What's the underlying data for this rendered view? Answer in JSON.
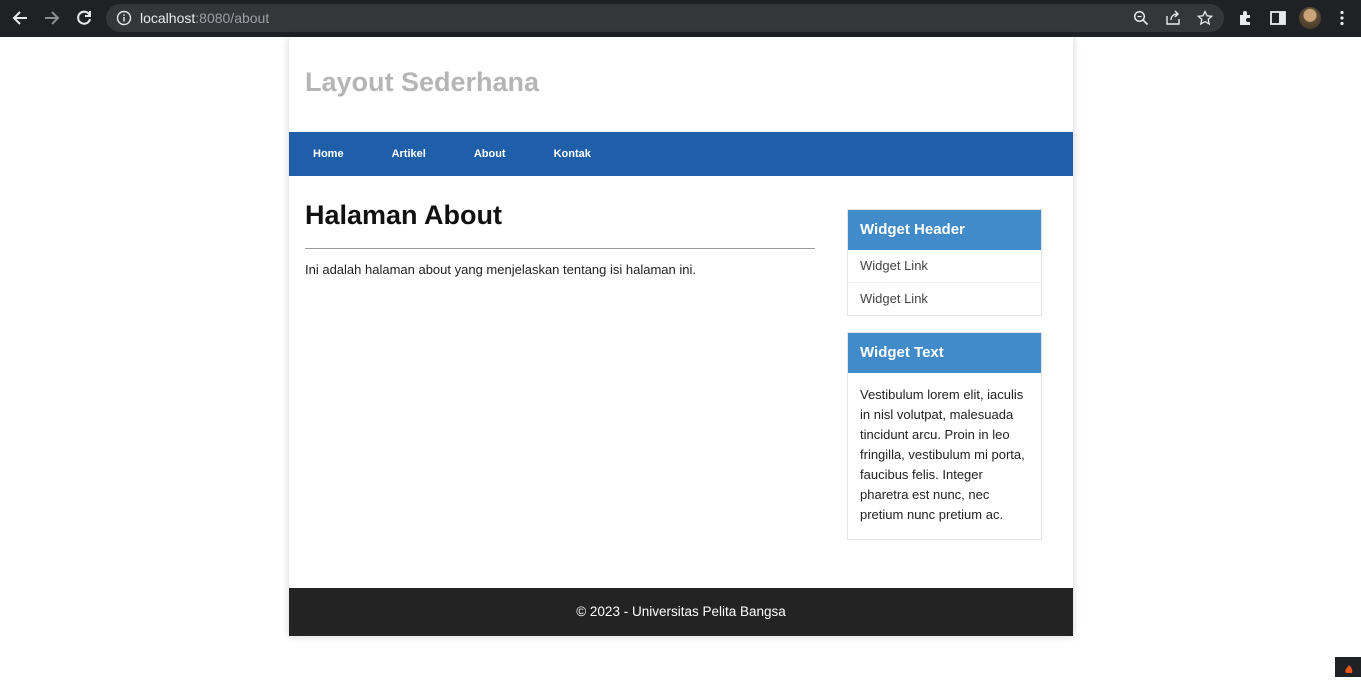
{
  "browser": {
    "url_host": "localhost",
    "url_rest": ":8080/about"
  },
  "site": {
    "title": "Layout Sederhana"
  },
  "nav": {
    "items": [
      "Home",
      "Artikel",
      "About",
      "Kontak"
    ]
  },
  "main": {
    "heading": "Halaman About",
    "body": "Ini adalah halaman about yang menjelaskan tentang isi halaman ini."
  },
  "sidebar": {
    "widget1": {
      "header": "Widget Header",
      "links": [
        "Widget Link",
        "Widget Link"
      ]
    },
    "widget2": {
      "header": "Widget Text",
      "text": "Vestibulum lorem elit, iaculis in nisl volutpat, malesuada tincidunt arcu. Proin in leo fringilla, vestibulum mi porta, faucibus felis. Integer pharetra est nunc, nec pretium nunc pretium ac."
    }
  },
  "footer": {
    "text": "© 2023 - Universitas Pelita Bangsa"
  },
  "colors": {
    "navbar": "#1f5faa",
    "widget_header": "#428bca",
    "footer": "#232323",
    "site_title": "#b5b5b5"
  }
}
